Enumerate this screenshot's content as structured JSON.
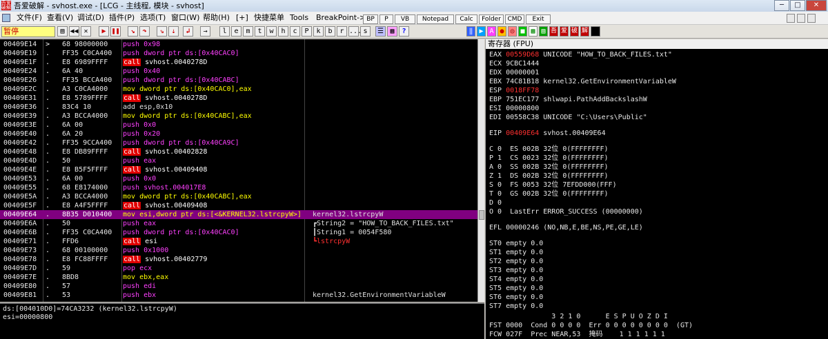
{
  "window": {
    "title": "吾爱破解 - svhost.exe - [LCG - 主线程, 模块 - svhost]",
    "icon_text": "吾爱破解"
  },
  "menu": [
    "文件(F)",
    "查看(V)",
    "调试(D)",
    "插件(P)",
    "选项(T)",
    "窗口(W)",
    "帮助(H)",
    "[+]",
    "快捷菜单",
    "Tools",
    "BreakPoint->"
  ],
  "menu_buttons": [
    "BP",
    "P",
    "VB",
    "Notepad",
    "Calc",
    "Folder",
    "CMD",
    "Exit"
  ],
  "toolbar": {
    "status": "暂停",
    "letters": [
      "l",
      "e",
      "m",
      "t",
      "w",
      "h",
      "c",
      "P",
      "k",
      "b",
      "r",
      "...",
      "s"
    ],
    "plugin_labels": [
      "A",
      "吾",
      "爱",
      "破",
      "解"
    ]
  },
  "disasm": [
    {
      "addr": "00409E14",
      "jmp": ">",
      "hex": "68 98000000",
      "mn": "push",
      "op": "0x98",
      "k": "push",
      "cmt": ""
    },
    {
      "addr": "00409E19",
      "jmp": ".",
      "hex": "FF35 C0CA400",
      "mn": "push",
      "op": "dword ptr ds:[0x40CAC0]",
      "k": "push",
      "cmt": ""
    },
    {
      "addr": "00409E1F",
      "jmp": ".",
      "hex": "E8 6989FFFF",
      "mn": "call",
      "op": "svhost.0040278D",
      "k": "call",
      "cmt": ""
    },
    {
      "addr": "00409E24",
      "jmp": ".",
      "hex": "6A 40",
      "mn": "push",
      "op": "0x40",
      "k": "push",
      "cmt": ""
    },
    {
      "addr": "00409E26",
      "jmp": ".",
      "hex": "FF35 BCCA400",
      "mn": "push",
      "op": "dword ptr ds:[0x40CABC]",
      "k": "push",
      "cmt": ""
    },
    {
      "addr": "00409E2C",
      "jmp": ".",
      "hex": "A3 C0CA4000",
      "mn": "mov",
      "op": "dword ptr ds:[0x40CAC0],eax",
      "k": "mov",
      "cmt": ""
    },
    {
      "addr": "00409E31",
      "jmp": ".",
      "hex": "E8 5789FFFF",
      "mn": "call",
      "op": "svhost.0040278D",
      "k": "call",
      "cmt": ""
    },
    {
      "addr": "00409E36",
      "jmp": ".",
      "hex": "83C4 10",
      "mn": "add",
      "op": "esp,0x10",
      "k": "op",
      "cmt": ""
    },
    {
      "addr": "00409E39",
      "jmp": ".",
      "hex": "A3 BCCA4000",
      "mn": "mov",
      "op": "dword ptr ds:[0x40CABC],eax",
      "k": "mov",
      "cmt": ""
    },
    {
      "addr": "00409E3E",
      "jmp": ".",
      "hex": "6A 00",
      "mn": "push",
      "op": "0x0",
      "k": "push",
      "cmt": ""
    },
    {
      "addr": "00409E40",
      "jmp": ".",
      "hex": "6A 20",
      "mn": "push",
      "op": "0x20",
      "k": "push",
      "cmt": ""
    },
    {
      "addr": "00409E42",
      "jmp": ".",
      "hex": "FF35 9CCA400",
      "mn": "push",
      "op": "dword ptr ds:[0x40CA9C]",
      "k": "push",
      "cmt": ""
    },
    {
      "addr": "00409E48",
      "jmp": ".",
      "hex": "E8 DB89FFFF",
      "mn": "call",
      "op": "svhost.00402828",
      "k": "call",
      "cmt": ""
    },
    {
      "addr": "00409E4D",
      "jmp": ".",
      "hex": "50",
      "mn": "push",
      "op": "eax",
      "k": "push",
      "cmt": ""
    },
    {
      "addr": "00409E4E",
      "jmp": ".",
      "hex": "E8 B5F5FFFF",
      "mn": "call",
      "op": "svhost.00409408",
      "k": "call",
      "cmt": ""
    },
    {
      "addr": "00409E53",
      "jmp": ".",
      "hex": "6A 00",
      "mn": "push",
      "op": "0x0",
      "k": "push",
      "cmt": ""
    },
    {
      "addr": "00409E55",
      "jmp": ".",
      "hex": "68 E8174000",
      "mn": "push",
      "op": "svhost.004017E8",
      "k": "push",
      "cmt": ""
    },
    {
      "addr": "00409E5A",
      "jmp": ".",
      "hex": "A3 BCCA4000",
      "mn": "mov",
      "op": "dword ptr ds:[0x40CABC],eax",
      "k": "mov",
      "cmt": ""
    },
    {
      "addr": "00409E5F",
      "jmp": ".",
      "hex": "E8 A4F5FFFF",
      "mn": "call",
      "op": "svhost.00409408",
      "k": "call",
      "cmt": ""
    },
    {
      "addr": "00409E64",
      "jmp": ".",
      "hex": "8B35 D010400",
      "mn": "mov",
      "op": "esi,dword ptr ds:[<&KERNEL32.lstrcpyW>]",
      "k": "mov",
      "cmt": "kernel32.lstrcpyW",
      "sel": true
    },
    {
      "addr": "00409E6A",
      "jmp": ".",
      "hex": "50",
      "mn": "push",
      "op": "eax",
      "k": "push",
      "cmt": "┏String2 = \"HOW_TO_BACK_FILES.txt\""
    },
    {
      "addr": "00409E6B",
      "jmp": ".",
      "hex": "FF35 C0CA400",
      "mn": "push",
      "op": "dword ptr ds:[0x40CAC0]",
      "k": "push",
      "cmt": "┃String1 = 0054F580"
    },
    {
      "addr": "00409E71",
      "jmp": ".",
      "hex": "FFD6",
      "mn": "call",
      "op": "esi",
      "k": "call",
      "cmt": "┗lstrcpyW"
    },
    {
      "addr": "00409E73",
      "jmp": ".",
      "hex": "68 00100000",
      "mn": "push",
      "op": "0x1000",
      "k": "push",
      "cmt": ""
    },
    {
      "addr": "00409E78",
      "jmp": ".",
      "hex": "E8 FC88FFFF",
      "mn": "call",
      "op": "svhost.00402779",
      "k": "call",
      "cmt": ""
    },
    {
      "addr": "00409E7D",
      "jmp": ".",
      "hex": "59",
      "mn": "pop",
      "op": "ecx",
      "k": "pop",
      "cmt": ""
    },
    {
      "addr": "00409E7E",
      "jmp": ".",
      "hex": "8BD8",
      "mn": "mov",
      "op": "ebx,eax",
      "k": "mov",
      "cmt": ""
    },
    {
      "addr": "00409E80",
      "jmp": ".",
      "hex": "57",
      "mn": "push",
      "op": "edi",
      "k": "push",
      "cmt": ""
    },
    {
      "addr": "00409E81",
      "jmp": ".",
      "hex": "53",
      "mn": "push",
      "op": "ebx",
      "k": "push",
      "cmt": "kernel32.GetEnvironmentVariableW"
    }
  ],
  "info": [
    "ds:[004010D0]=74CA3232 (kernel32.lstrcpyW)",
    "esi=00000800"
  ],
  "registers_header": "寄存器 (FPU)",
  "registers": [
    {
      "t": "EAX ",
      "v": "00559D68",
      "r": true,
      "x": " UNICODE \"HOW_TO_BACK_FILES.txt\""
    },
    {
      "t": "ECX ",
      "v": "9CBC1444",
      "r": false,
      "x": ""
    },
    {
      "t": "EDX ",
      "v": "00000001",
      "r": false,
      "x": ""
    },
    {
      "t": "EBX ",
      "v": "74C81B18",
      "r": false,
      "x": " kernel32.GetEnvironmentVariableW"
    },
    {
      "t": "ESP ",
      "v": "0018FF78",
      "r": true,
      "x": ""
    },
    {
      "t": "EBP ",
      "v": "751EC177",
      "r": false,
      "x": " shlwapi.PathAddBackslashW"
    },
    {
      "t": "ESI ",
      "v": "00000800",
      "r": false,
      "x": ""
    },
    {
      "t": "EDI ",
      "v": "00558C38",
      "r": false,
      "x": " UNICODE \"C:\\Users\\Public\""
    },
    {
      "t": "EIP ",
      "v": "00409E64",
      "r": true,
      "x": " svhost.00409E64"
    }
  ],
  "flags": [
    "C 0  ES 002B 32位 0(FFFFFFFF)",
    "P 1  CS 0023 32位 0(FFFFFFFF)",
    "A 0  SS 002B 32位 0(FFFFFFFF)",
    "Z 1  DS 002B 32位 0(FFFFFFFF)",
    "S 0  FS 0053 32位 7EFDD000(FFF)",
    "T 0  GS 002B 32位 0(FFFFFFFF)",
    "D 0",
    "O 0  LastErr ERROR_SUCCESS (00000000)",
    "EFL 00000246 (NO,NB,E,BE,NS,PE,GE,LE)"
  ],
  "fpu": [
    "ST0 empty 0.0",
    "ST1 empty 0.0",
    "ST2 empty 0.0",
    "ST3 empty 0.0",
    "ST4 empty 0.0",
    "ST5 empty 0.0",
    "ST6 empty 0.0",
    "ST7 empty 0.0"
  ],
  "fpu_status": [
    "               3 2 1 0      E S P U O Z D I",
    "FST 0000  Cond 0 0 0 0  Err 0 0 0 0 0 0 0 0  (GT)",
    "FCW 027F  Prec NEAR,53  掩码    1 1 1 1 1 1"
  ]
}
